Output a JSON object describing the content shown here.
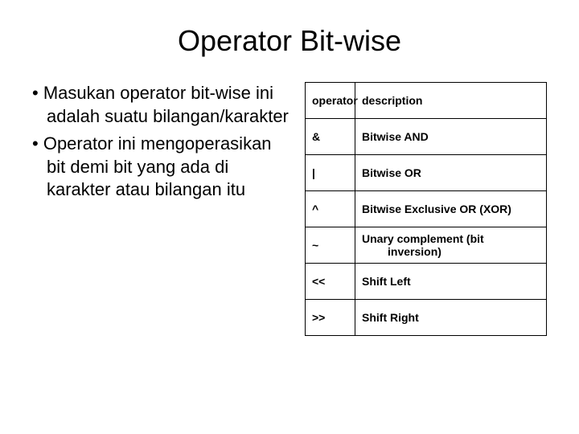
{
  "title": "Operator Bit-wise",
  "bullets": [
    "Masukan operator bit-wise ini adalah suatu bilangan/karakter",
    "Operator ini mengoperasikan bit demi bit yang ada di karakter atau bilangan itu"
  ],
  "table": {
    "header": {
      "op": "operator",
      "desc": "description"
    },
    "rows": [
      {
        "op": "&",
        "desc": "Bitwise AND"
      },
      {
        "op": "|",
        "desc": "Bitwise OR"
      },
      {
        "op": "^",
        "desc": "Bitwise Exclusive OR (XOR)"
      },
      {
        "op": "~",
        "desc": "Unary complement (bit inversion)"
      },
      {
        "op": "<<",
        "desc": "Shift Left"
      },
      {
        "op": ">>",
        "desc": "Shift Right"
      }
    ]
  }
}
